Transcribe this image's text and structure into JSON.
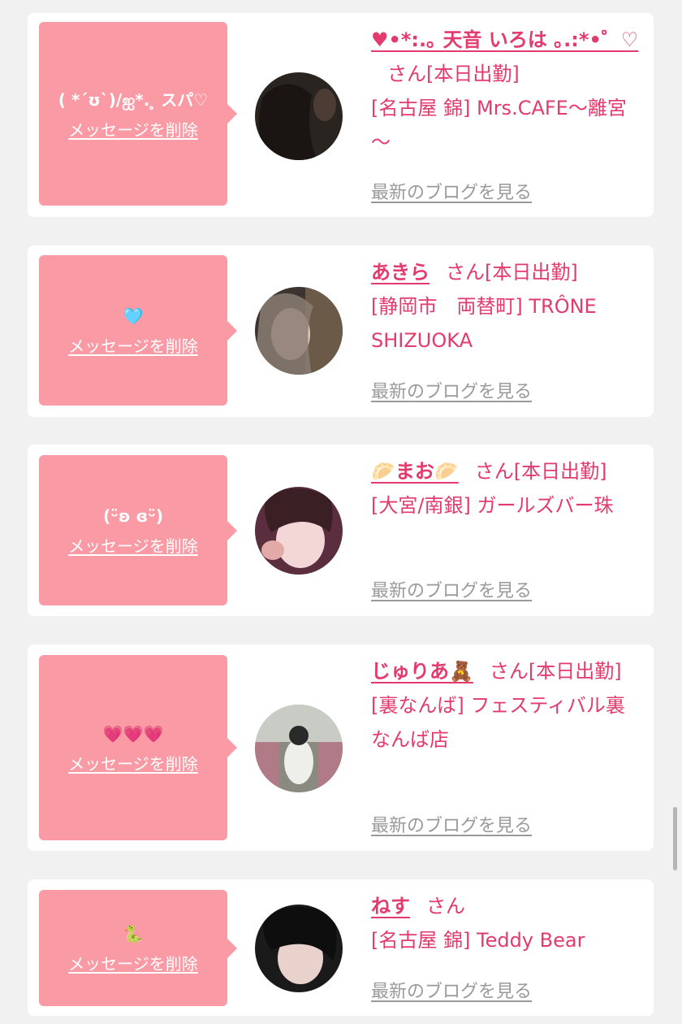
{
  "cards": [
    {
      "message": "( *´ʊ`)/ஐ*. ̥ スパ♡",
      "delete_label": "メッセージを削除",
      "name": "♥•*:.｡ 天音 いろは ｡.:*•゜♡",
      "san": "さん",
      "status": "[本日出勤]",
      "shop": "[名古屋 錦] Mrs.CAFE～離宮～",
      "blog_label": "最新のブログを見る"
    },
    {
      "message": "🩵",
      "delete_label": "メッセージを削除",
      "name": "あきら",
      "san": "さん",
      "status": "[本日出勤]",
      "shop": "[静岡市　両替町] TRÔNE SHIZUOKA",
      "blog_label": "最新のブログを見る"
    },
    {
      "message": "(ᵕ̈ʚ ɞᵕ̈)",
      "delete_label": "メッセージを削除",
      "name": "🥟まお🥟",
      "san": "さん",
      "status": "[本日出勤]",
      "shop": "[大宮/南銀] ガールズバー珠",
      "blog_label": "最新のブログを見る"
    },
    {
      "message": "💗💗💗",
      "delete_label": "メッセージを削除",
      "name": "じゅりあ🧸",
      "san": "さん",
      "status": "[本日出勤]",
      "shop": "[裏なんば] フェスティバル裏なんば店",
      "blog_label": "最新のブログを見る"
    },
    {
      "message": "🐍",
      "delete_label": "メッセージを削除",
      "name": "ねす",
      "san": "さん",
      "status": "",
      "shop": "[名古屋 錦] Teddy Bear",
      "blog_label": "最新のブログを見る"
    }
  ],
  "colors": {
    "page_bg": "#f1f1f1",
    "bubble": "#f99aa5",
    "accent": "#e33b6d",
    "link_gray": "#9a9a9a"
  }
}
